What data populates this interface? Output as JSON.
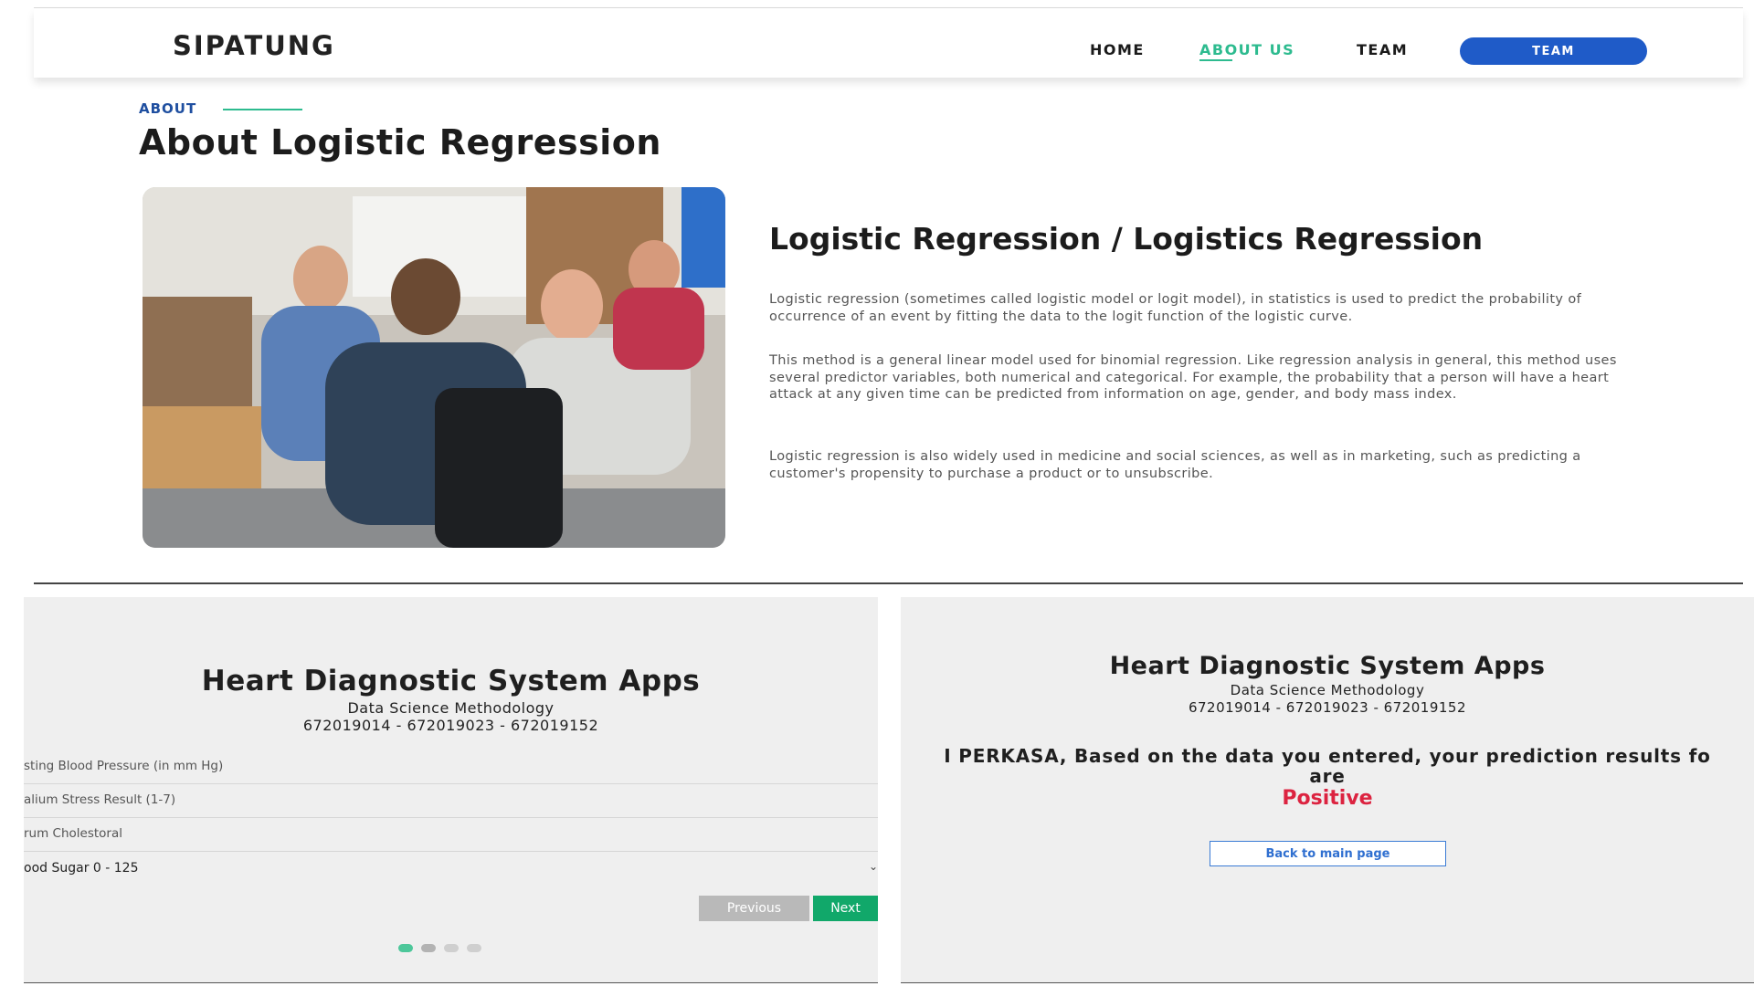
{
  "nav": {
    "brand": "SIPATUNG",
    "links": [
      "HOME",
      "ABOUT US",
      "TEAM"
    ],
    "button": "TEAM"
  },
  "about": {
    "eyebrow": "ABOUT",
    "title": "About Logistic Regression",
    "article_title": "Logistic Regression / Logistics Regression",
    "paragraphs": [
      "Logistic regression (sometimes called logistic model or logit model), in statistics is used to predict the probability of occurrence of an event by fitting the data to the logit function of the logistic curve.",
      "This method is a general linear model used for binomial regression. Like regression analysis in general, this method uses several predictor variables, both numerical and categorical. For example, the probability that a person will have a heart attack at any given time can be predicted from information on age, gender, and body mass index.",
      "Logistic regression is also widely used in medicine and social sciences, as well as in marketing, such as predicting a customer's propensity to purchase a product or to unsubscribe."
    ]
  },
  "form_panel": {
    "title": "Heart Diagnostic System Apps",
    "subtitle": "Data Science Methodology",
    "ids": "672019014 - 672019023 - 672019152",
    "fields": [
      "sting Blood Pressure (in mm Hg)",
      "alium Stress Result (1-7)",
      "rum Cholestoral"
    ],
    "select_value": "ood Sugar 0 - 125",
    "previous": "Previous",
    "next": "Next"
  },
  "result_panel": {
    "title": "Heart Diagnostic System Apps",
    "subtitle": "Data Science Methodology",
    "ids": "672019014 - 672019023 - 672019152",
    "message_line1": "I PERKASA, Based on the data you entered, your prediction results fo",
    "message_line2": "are",
    "result": "Positive",
    "back_button": "Back to main page"
  },
  "colors": {
    "accent_green": "#2dbb8f",
    "nav_button_blue": "#1f5bc8",
    "next_green": "#11a86a",
    "positive_red": "#dc2340"
  }
}
